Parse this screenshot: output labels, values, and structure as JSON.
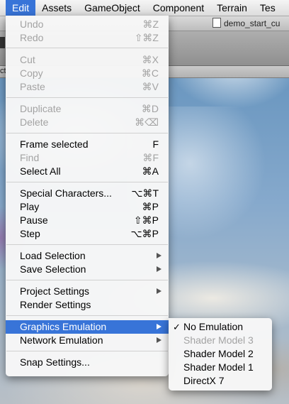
{
  "menubar": {
    "items": [
      "Edit",
      "Assets",
      "GameObject",
      "Component",
      "Terrain",
      "Tes"
    ],
    "active_index": 0
  },
  "window": {
    "title": "demo_start_cu"
  },
  "tab": {
    "stub": "ct"
  },
  "edit_menu": {
    "items": [
      {
        "label": "Undo",
        "shortcut": "⌘Z",
        "enabled": false
      },
      {
        "label": "Redo",
        "shortcut": "⇧⌘Z",
        "enabled": false
      },
      {
        "label": "Cut",
        "shortcut": "⌘X",
        "enabled": false
      },
      {
        "label": "Copy",
        "shortcut": "⌘C",
        "enabled": false
      },
      {
        "label": "Paste",
        "shortcut": "⌘V",
        "enabled": false
      },
      {
        "label": "Duplicate",
        "shortcut": "⌘D",
        "enabled": false
      },
      {
        "label": "Delete",
        "shortcut": "⌘⌫",
        "enabled": false
      },
      {
        "label": "Frame selected",
        "shortcut": "F",
        "enabled": true
      },
      {
        "label": "Find",
        "shortcut": "⌘F",
        "enabled": false
      },
      {
        "label": "Select All",
        "shortcut": "⌘A",
        "enabled": true
      },
      {
        "label": "Special Characters...",
        "shortcut": "⌥⌘T",
        "enabled": true
      },
      {
        "label": "Play",
        "shortcut": "⌘P",
        "enabled": true
      },
      {
        "label": "Pause",
        "shortcut": "⇧⌘P",
        "enabled": true
      },
      {
        "label": "Step",
        "shortcut": "⌥⌘P",
        "enabled": true
      },
      {
        "label": "Load Selection",
        "submenu": true,
        "enabled": true
      },
      {
        "label": "Save Selection",
        "submenu": true,
        "enabled": true
      },
      {
        "label": "Project Settings",
        "submenu": true,
        "enabled": true
      },
      {
        "label": "Render Settings",
        "enabled": true
      },
      {
        "label": "Graphics Emulation",
        "submenu": true,
        "enabled": true,
        "highlighted": true
      },
      {
        "label": "Network Emulation",
        "submenu": true,
        "enabled": true
      },
      {
        "label": "Snap Settings...",
        "enabled": true
      }
    ]
  },
  "graphics_emulation_submenu": {
    "items": [
      {
        "label": "No Emulation",
        "checked": true,
        "enabled": true
      },
      {
        "label": "Shader Model 3",
        "checked": false,
        "enabled": false
      },
      {
        "label": "Shader Model 2",
        "checked": false,
        "enabled": true
      },
      {
        "label": "Shader Model 1",
        "checked": false,
        "enabled": true
      },
      {
        "label": "DirectX 7",
        "checked": false,
        "enabled": true
      }
    ],
    "check_glyph": "✓"
  },
  "colors": {
    "highlight": "#3874d8",
    "disabled_text": "#a3a3a3"
  }
}
